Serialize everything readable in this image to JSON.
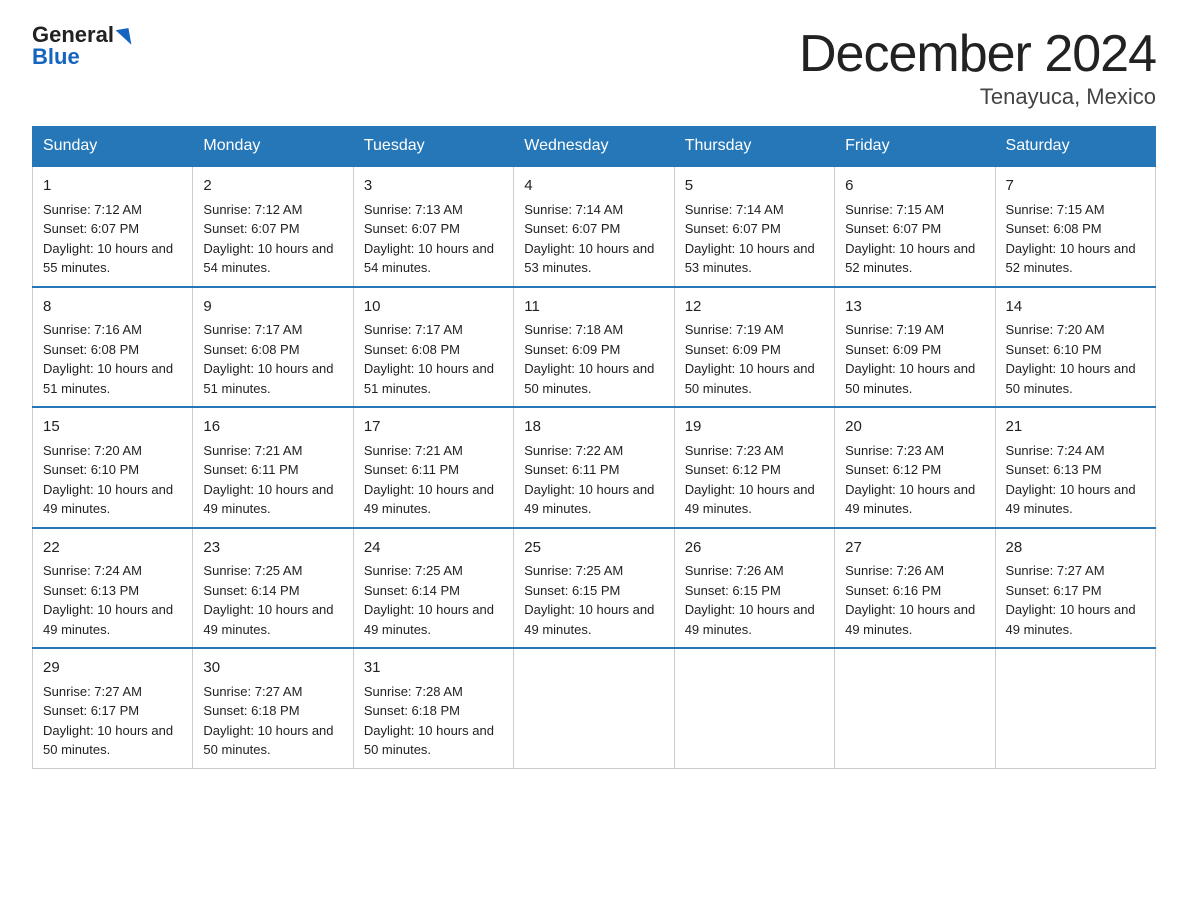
{
  "header": {
    "logo_general": "General",
    "logo_blue": "Blue",
    "title": "December 2024",
    "subtitle": "Tenayuca, Mexico"
  },
  "days_of_week": [
    "Sunday",
    "Monday",
    "Tuesday",
    "Wednesday",
    "Thursday",
    "Friday",
    "Saturday"
  ],
  "weeks": [
    [
      {
        "day": "1",
        "sunrise": "7:12 AM",
        "sunset": "6:07 PM",
        "daylight": "10 hours and 55 minutes."
      },
      {
        "day": "2",
        "sunrise": "7:12 AM",
        "sunset": "6:07 PM",
        "daylight": "10 hours and 54 minutes."
      },
      {
        "day": "3",
        "sunrise": "7:13 AM",
        "sunset": "6:07 PM",
        "daylight": "10 hours and 54 minutes."
      },
      {
        "day": "4",
        "sunrise": "7:14 AM",
        "sunset": "6:07 PM",
        "daylight": "10 hours and 53 minutes."
      },
      {
        "day": "5",
        "sunrise": "7:14 AM",
        "sunset": "6:07 PM",
        "daylight": "10 hours and 53 minutes."
      },
      {
        "day": "6",
        "sunrise": "7:15 AM",
        "sunset": "6:07 PM",
        "daylight": "10 hours and 52 minutes."
      },
      {
        "day": "7",
        "sunrise": "7:15 AM",
        "sunset": "6:08 PM",
        "daylight": "10 hours and 52 minutes."
      }
    ],
    [
      {
        "day": "8",
        "sunrise": "7:16 AM",
        "sunset": "6:08 PM",
        "daylight": "10 hours and 51 minutes."
      },
      {
        "day": "9",
        "sunrise": "7:17 AM",
        "sunset": "6:08 PM",
        "daylight": "10 hours and 51 minutes."
      },
      {
        "day": "10",
        "sunrise": "7:17 AM",
        "sunset": "6:08 PM",
        "daylight": "10 hours and 51 minutes."
      },
      {
        "day": "11",
        "sunrise": "7:18 AM",
        "sunset": "6:09 PM",
        "daylight": "10 hours and 50 minutes."
      },
      {
        "day": "12",
        "sunrise": "7:19 AM",
        "sunset": "6:09 PM",
        "daylight": "10 hours and 50 minutes."
      },
      {
        "day": "13",
        "sunrise": "7:19 AM",
        "sunset": "6:09 PM",
        "daylight": "10 hours and 50 minutes."
      },
      {
        "day": "14",
        "sunrise": "7:20 AM",
        "sunset": "6:10 PM",
        "daylight": "10 hours and 50 minutes."
      }
    ],
    [
      {
        "day": "15",
        "sunrise": "7:20 AM",
        "sunset": "6:10 PM",
        "daylight": "10 hours and 49 minutes."
      },
      {
        "day": "16",
        "sunrise": "7:21 AM",
        "sunset": "6:11 PM",
        "daylight": "10 hours and 49 minutes."
      },
      {
        "day": "17",
        "sunrise": "7:21 AM",
        "sunset": "6:11 PM",
        "daylight": "10 hours and 49 minutes."
      },
      {
        "day": "18",
        "sunrise": "7:22 AM",
        "sunset": "6:11 PM",
        "daylight": "10 hours and 49 minutes."
      },
      {
        "day": "19",
        "sunrise": "7:23 AM",
        "sunset": "6:12 PM",
        "daylight": "10 hours and 49 minutes."
      },
      {
        "day": "20",
        "sunrise": "7:23 AM",
        "sunset": "6:12 PM",
        "daylight": "10 hours and 49 minutes."
      },
      {
        "day": "21",
        "sunrise": "7:24 AM",
        "sunset": "6:13 PM",
        "daylight": "10 hours and 49 minutes."
      }
    ],
    [
      {
        "day": "22",
        "sunrise": "7:24 AM",
        "sunset": "6:13 PM",
        "daylight": "10 hours and 49 minutes."
      },
      {
        "day": "23",
        "sunrise": "7:25 AM",
        "sunset": "6:14 PM",
        "daylight": "10 hours and 49 minutes."
      },
      {
        "day": "24",
        "sunrise": "7:25 AM",
        "sunset": "6:14 PM",
        "daylight": "10 hours and 49 minutes."
      },
      {
        "day": "25",
        "sunrise": "7:25 AM",
        "sunset": "6:15 PM",
        "daylight": "10 hours and 49 minutes."
      },
      {
        "day": "26",
        "sunrise": "7:26 AM",
        "sunset": "6:15 PM",
        "daylight": "10 hours and 49 minutes."
      },
      {
        "day": "27",
        "sunrise": "7:26 AM",
        "sunset": "6:16 PM",
        "daylight": "10 hours and 49 minutes."
      },
      {
        "day": "28",
        "sunrise": "7:27 AM",
        "sunset": "6:17 PM",
        "daylight": "10 hours and 49 minutes."
      }
    ],
    [
      {
        "day": "29",
        "sunrise": "7:27 AM",
        "sunset": "6:17 PM",
        "daylight": "10 hours and 50 minutes."
      },
      {
        "day": "30",
        "sunrise": "7:27 AM",
        "sunset": "6:18 PM",
        "daylight": "10 hours and 50 minutes."
      },
      {
        "day": "31",
        "sunrise": "7:28 AM",
        "sunset": "6:18 PM",
        "daylight": "10 hours and 50 minutes."
      },
      null,
      null,
      null,
      null
    ]
  ]
}
